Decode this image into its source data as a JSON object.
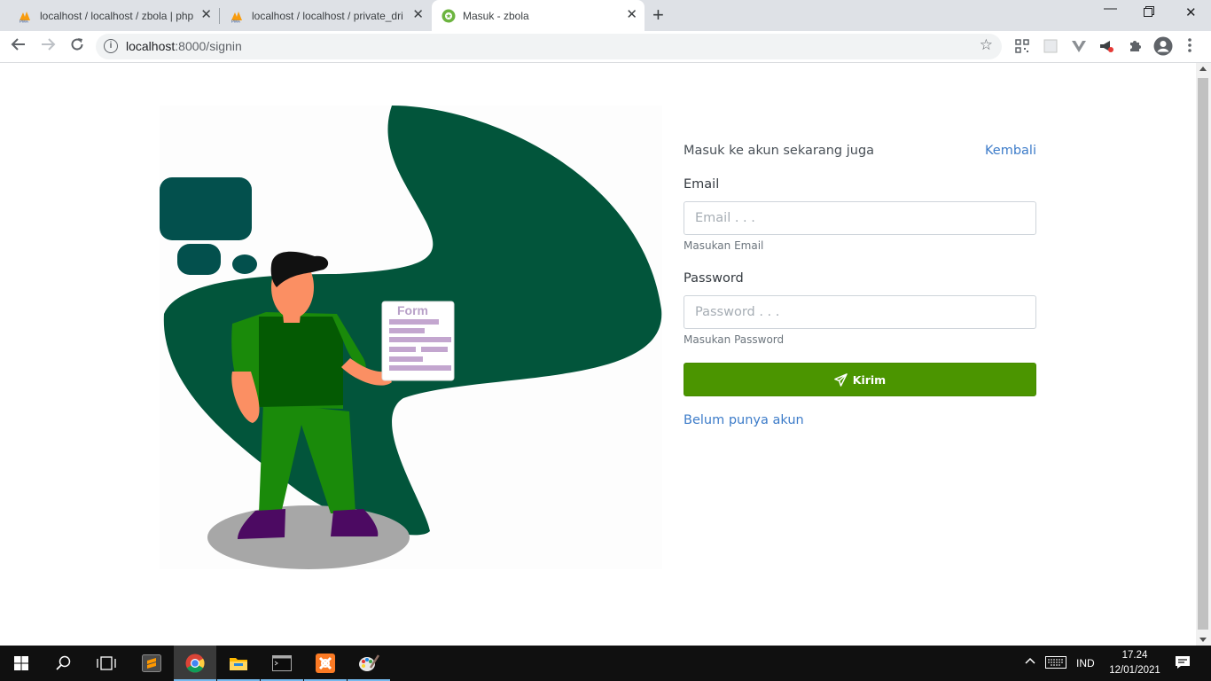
{
  "browser": {
    "tabs": [
      {
        "title": "localhost / localhost / zbola | php",
        "icon": "phpmyadmin-icon",
        "active": false
      },
      {
        "title": "localhost / localhost / private_dri",
        "icon": "phpmyadmin-icon",
        "active": false
      },
      {
        "title": "Masuk - zbola",
        "icon": "site-favicon",
        "active": true
      }
    ],
    "new_tab_label": "+",
    "url_host": "localhost",
    "url_path": ":8000/signin",
    "window_controls": [
      "minimize",
      "maximize",
      "close"
    ]
  },
  "illustration": {
    "form_card_title": "Form"
  },
  "form": {
    "title": "Masuk ke akun sekarang juga",
    "back_link": "Kembali",
    "email_label": "Email",
    "email_placeholder": "Email . . .",
    "email_help": "Masukan Email",
    "password_label": "Password",
    "password_placeholder": "Password . . .",
    "password_help": "Masukan Password",
    "submit_label": "Kirim",
    "register_link": "Belum punya akun"
  },
  "taskbar": {
    "apps": [
      "windows-start-icon",
      "search-icon",
      "task-view-icon",
      "sublime-text-icon",
      "chrome-icon",
      "file-explorer-icon",
      "terminal-icon",
      "xampp-icon",
      "paint-icon"
    ],
    "language": "IND",
    "time": "17.24",
    "date": "12/01/2021"
  },
  "colors": {
    "primary_green": "#4b9500",
    "blob_green": "#02553b",
    "link_blue": "#3d7cc9"
  }
}
